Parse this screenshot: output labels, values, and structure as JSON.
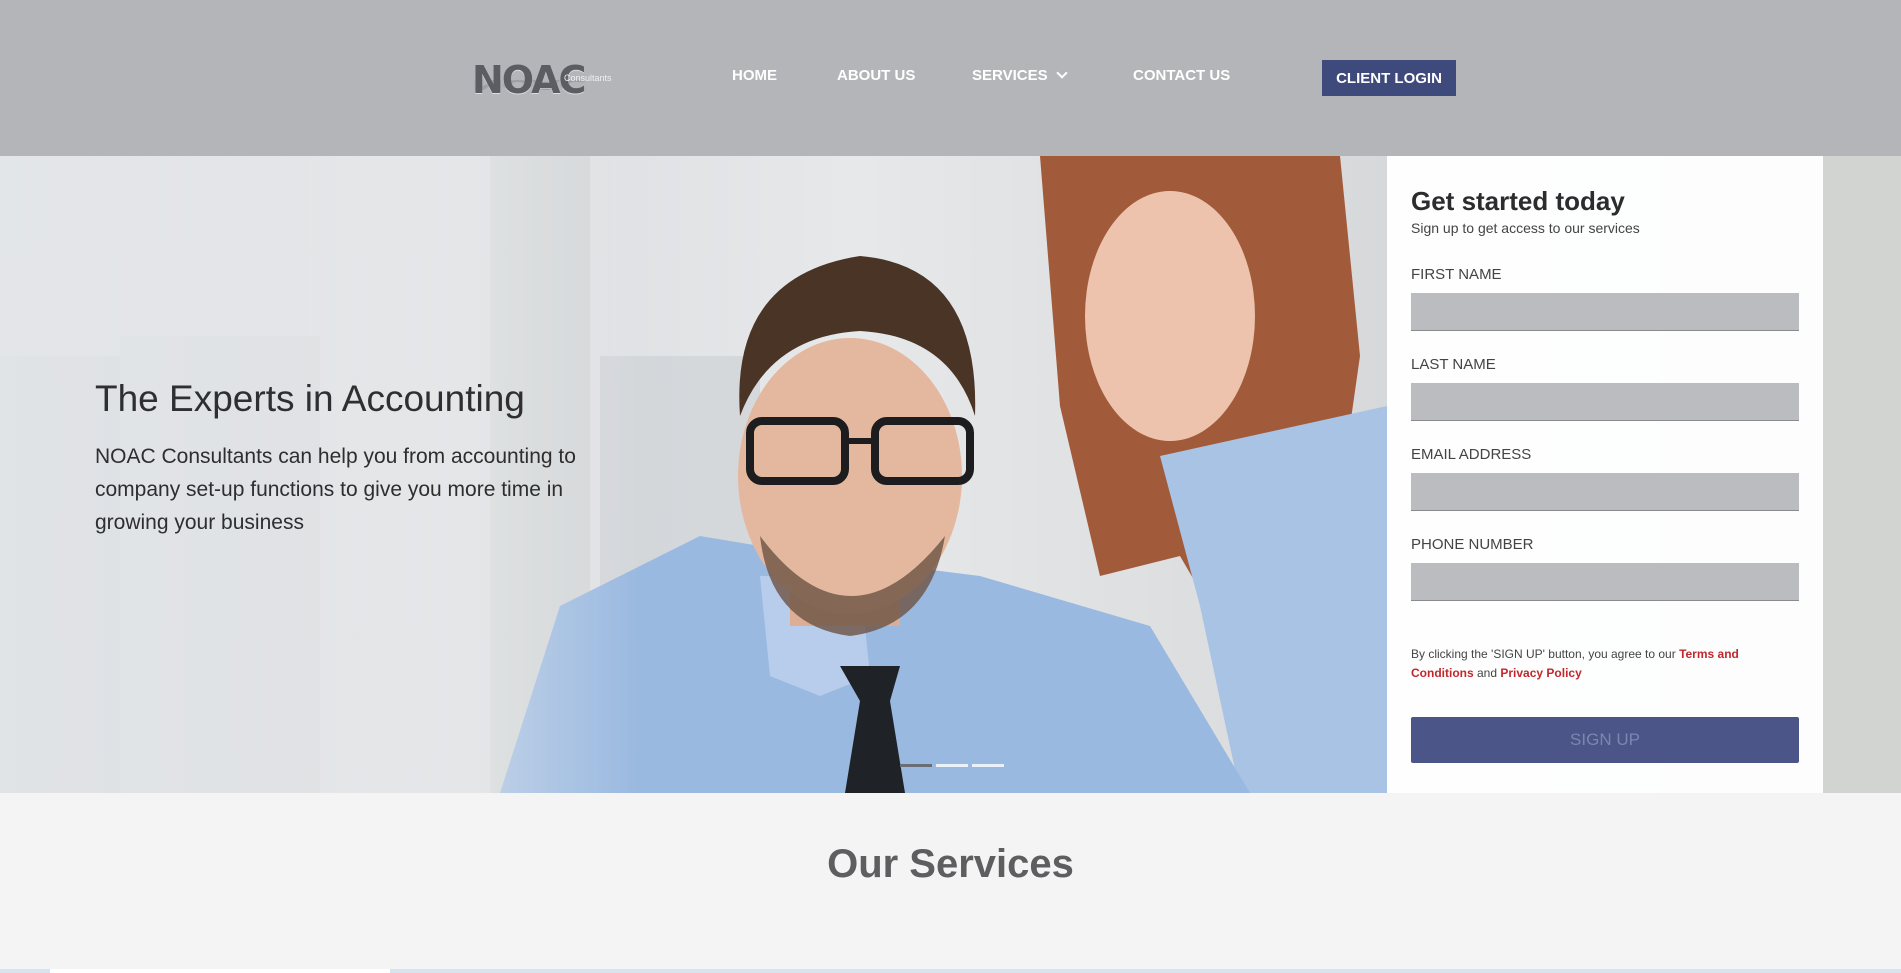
{
  "header": {
    "logo_text": "NOAC",
    "logo_subtext": "Consultants",
    "nav": {
      "home": "HOME",
      "about": "ABOUT US",
      "services": "SERVICES",
      "contact": "CONTACT US"
    },
    "login_label": "CLIENT LOGIN"
  },
  "hero": {
    "title": "The Experts in Accounting",
    "text": "NOAC Consultants can help you from accounting to company set-up functions to give you more time in growing your business",
    "slides_count": 3,
    "active_slide": 1
  },
  "signup": {
    "title": "Get started today",
    "subtitle": "Sign up to get access to our services",
    "fields": {
      "first_name": "FIRST NAME",
      "last_name": "LAST NAME",
      "email": "EMAIL ADDRESS",
      "phone": "PHONE NUMBER"
    },
    "terms_prefix": "By clicking the 'SIGN UP' button, you agree to our",
    "terms_link": "Terms and Conditions",
    "terms_and": "and",
    "privacy_link": "Privacy Policy",
    "button_label": "SIGN UP"
  },
  "services": {
    "title": "Our Services"
  },
  "colors": {
    "header_bg": "#b4b5b9",
    "accent": "#3e4a7c",
    "link_red": "#c0282d"
  }
}
